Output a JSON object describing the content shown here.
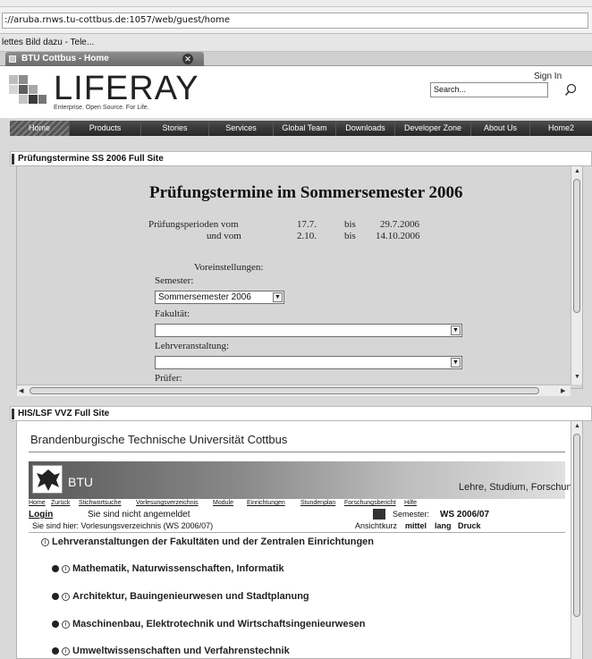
{
  "browser": {
    "url": "://aruba.rnws.tu-cottbus.de:1057/web/guest/home",
    "links_bar": "lettes Bild dazu - Tele...",
    "tab_title": "BTU Cottbus - Home"
  },
  "liferay": {
    "logo": "LIFERAY",
    "tagline": "Enterprise. Open Source. For Life.",
    "sign_in": "Sign In",
    "search_placeholder": "Search...",
    "nav": [
      "Home",
      "Products",
      "Stories",
      "Services",
      "Global Team",
      "Downloads",
      "Developer Zone",
      "About Us",
      "Home2"
    ]
  },
  "portlet1": {
    "title": "Prüfungstermine SS 2006 Full Site",
    "heading": "Prüfungstermine im Sommersemester 2006",
    "periods_label1": "Prüfungsperioden vom",
    "periods_label2": "und vom",
    "p1_from": "17.7.",
    "p1_bis": "bis",
    "p1_to": "29.7.2006",
    "p2_from": "2.10.",
    "p2_bis": "bis",
    "p2_to": "14.10.2006",
    "settings_label": "Voreinstellungen:",
    "semester_label": "Semester:",
    "semester_value": "Sommersemester 2006",
    "fakultaet_label": "Fakultät:",
    "lv_label": "Lehrveranstaltung:",
    "pruefer_label": "Prüfer:"
  },
  "portlet2": {
    "title": "HIS/LSF VVZ Full Site",
    "university": "Brandenburgische Technische Universität Cottbus",
    "banner_logo_text": "BTU",
    "slogan": "Lehre, Studium, Forschung",
    "menu": [
      "Home",
      "Zurück",
      "Stichwortsuche",
      "Vorlesungsverzeichnis",
      "Module",
      "Einrichtungen",
      "Stundenplan",
      "Forschungsbericht",
      "Hilfe"
    ],
    "login": "Login",
    "not_logged_in": "Sie sind nicht angemeldet",
    "semester_label": "Semester:",
    "semester_value": "WS 2006/07",
    "breadcrumb": "Sie sind hier:  Vorlesungsverzeichnis (WS 2006/07)",
    "view_label": "Ansicht:",
    "view_options": [
      "kurz",
      "mittel",
      "lang",
      "Druck"
    ],
    "list_heading": "Lehrveranstaltungen der Fakultäten und der Zentralen Einrichtungen",
    "items": [
      "Mathematik, Naturwissenschaften, Informatik",
      "Architektur, Bauingenieurwesen und Stadtplanung",
      "Maschinenbau, Elektrotechnik und Wirtschaftsingenieurwesen",
      "Umweltwissenschaften und Verfahrenstechnik"
    ]
  }
}
